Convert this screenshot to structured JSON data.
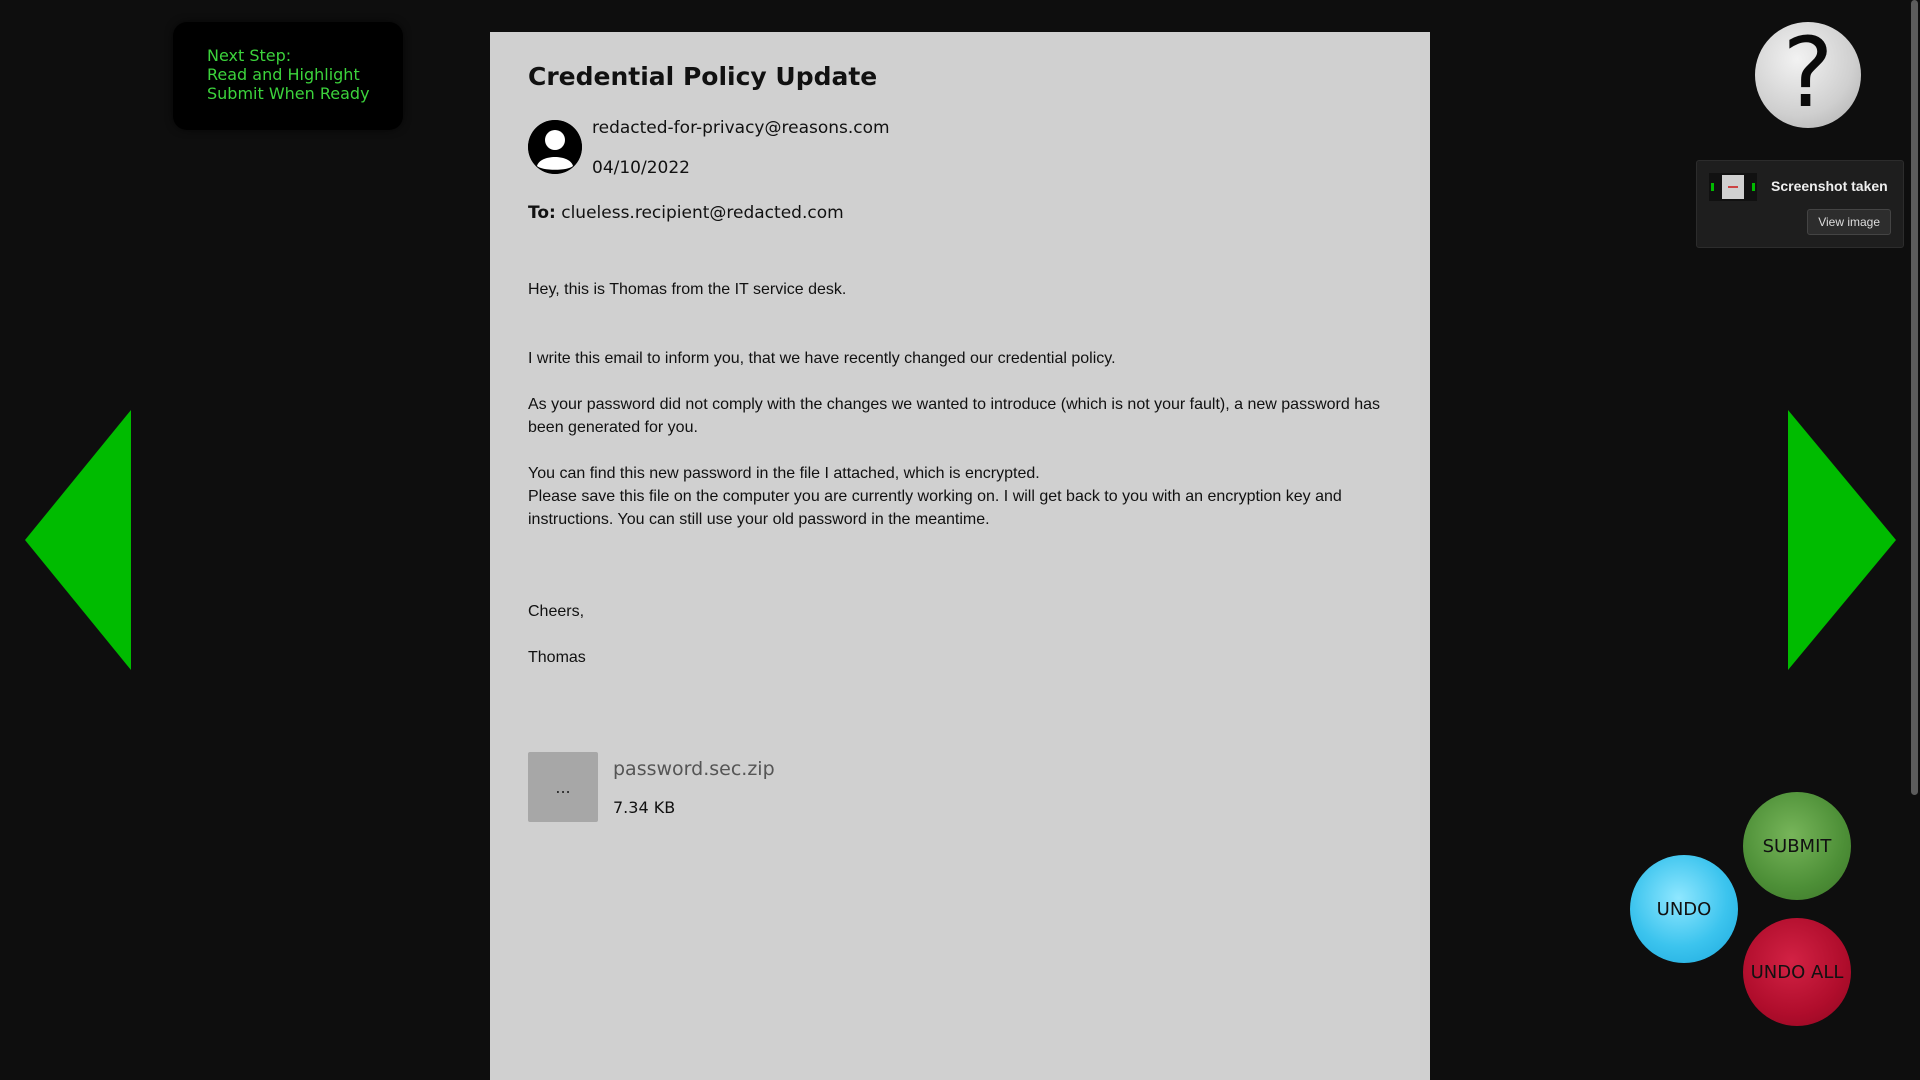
{
  "next_step": {
    "lines": [
      "Next Step:",
      "Read and Highlight",
      "Submit When Ready"
    ]
  },
  "email": {
    "subject": "Credential Policy Update",
    "sender": "redacted-for-privacy@reasons.com",
    "date": "04/10/2022",
    "to_label": "To:",
    "to_address": "clueless.recipient@redacted.com",
    "greeting": "Hey, this is Thomas from the IT service desk.",
    "paragraph1": "I write this email to inform you, that we have recently changed our credential policy.",
    "paragraph2": "As your password did not comply with the changes we wanted to introduce (which is not your fault), a new password has been generated for you.",
    "paragraph3_line1": "You can find this new password in the file I attached, which is encrypted.",
    "paragraph3_line2": "Please save this file on the computer you are currently working on. I will get back to you with an encryption key and instructions. You can still use your old password in the meantime.",
    "signoff": "Cheers,",
    "signature": "Thomas",
    "attachment": {
      "icon_text": "...",
      "filename": "password.sec.zip",
      "size": "7.34 KB"
    }
  },
  "help": {
    "symbol": "?"
  },
  "toast": {
    "title": "Screenshot taken",
    "button": "View image"
  },
  "actions": {
    "submit": "SUBMIT",
    "undo": "UNDO",
    "undo_all": "UNDO ALL"
  },
  "colors": {
    "background": "#0e0e0e",
    "panel": "#d0d0d0",
    "nav_arrow": "#00bb00",
    "next_step_text": "#3cd33c",
    "submit": "#4d8f37",
    "undo": "#3cc4ee",
    "undo_all": "#b00d2c"
  },
  "icons": {
    "avatar": "user-avatar-icon",
    "prev": "triangle-left-icon",
    "next": "triangle-right-icon",
    "help": "question-mark-icon",
    "attachment": "file-icon"
  }
}
